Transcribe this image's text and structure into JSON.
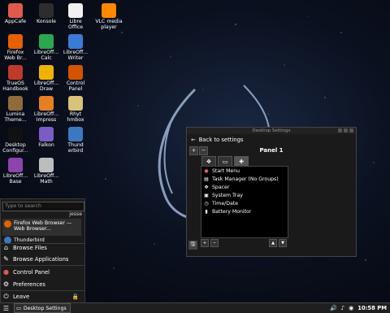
{
  "desktop": {
    "icons": [
      {
        "name": "appcafe",
        "label": "AppCafe",
        "icon": "appcafe-icon",
        "color": "#e05a4c"
      },
      {
        "name": "konsole",
        "label": "Konsole",
        "icon": "terminal-icon",
        "color": "#2d2d2d"
      },
      {
        "name": "libreoffice",
        "label": "Libre\nOffice",
        "icon": "document-icon",
        "color": "#f2f2f2"
      },
      {
        "name": "vlc",
        "label": "VLC media\nplayer",
        "icon": "vlc-cone-icon",
        "color": "#ff8800"
      },
      {
        "name": "firefox",
        "label": "Firefox\nWeb Br...",
        "icon": "firefox-icon",
        "color": "#e66000"
      },
      {
        "name": "calc",
        "label": "LibreOff...\nCalc",
        "icon": "spreadsheet-icon",
        "color": "#2aa74f"
      },
      {
        "name": "writer",
        "label": "LibreOff...\nWriter",
        "icon": "writer-icon",
        "color": "#3a7bd5"
      },
      {
        "name": "handbook",
        "label": "TrueOS\nHandbook",
        "icon": "handbook-icon",
        "color": "#c0392b"
      },
      {
        "name": "draw",
        "label": "LibreOff...\nDraw",
        "icon": "draw-icon",
        "color": "#f0b400"
      },
      {
        "name": "control-panel",
        "label": "Control\nPanel",
        "icon": "control-panel-icon",
        "color": "#d35400"
      },
      {
        "name": "lumina-theme",
        "label": "Lumina\nTheme...",
        "icon": "paint-palette-icon",
        "color": "#8e6c3a"
      },
      {
        "name": "impress",
        "label": "LibreOff...\nImpress",
        "icon": "impress-icon",
        "color": "#e67e22"
      },
      {
        "name": "rhythmbox",
        "label": "Rhyt\nhmbox",
        "icon": "rhythmbox-icon",
        "color": "#d9c27a"
      },
      {
        "name": "desktop-config",
        "label": "Desktop\nConfigur...",
        "icon": "monitor-icon",
        "color": "#111111"
      },
      {
        "name": "falkon",
        "label": "Falkon",
        "icon": "falkon-icon",
        "color": "#7b5cc4"
      },
      {
        "name": "thunderbird",
        "label": "Thund\nerbird",
        "icon": "thunderbird-icon",
        "color": "#3b78c2"
      },
      {
        "name": "base",
        "label": "LibreOff...\nBase",
        "icon": "base-icon",
        "color": "#8e44ad"
      },
      {
        "name": "math",
        "label": "LibreOff...\nMath",
        "icon": "math-icon",
        "color": "#bdbdbd"
      }
    ]
  },
  "start_menu": {
    "search_placeholder": "Type to search",
    "user": "jesse",
    "favorites": [
      {
        "label": "Firefox Web Browser — Web Browser...",
        "color": "#e66000"
      },
      {
        "label": "Thunderbird",
        "color": "#3b78c2"
      }
    ],
    "items": {
      "browse_files": "Browse Files",
      "browse_apps": "Browse Applications",
      "control_panel": "Control Panel",
      "preferences": "Preferences",
      "leave": "Leave"
    }
  },
  "window": {
    "title": "Desktop Settings",
    "back_label": "Back to settings",
    "panel_title": "Panel 1",
    "plugins": [
      {
        "label": "Start Menu",
        "icon": "start-menu-icon"
      },
      {
        "label": "Task Manager (No Groups)",
        "icon": "task-manager-icon"
      },
      {
        "label": "Spacer",
        "icon": "spacer-arrows-icon"
      },
      {
        "label": "System Tray",
        "icon": "system-tray-icon"
      },
      {
        "label": "Time/Date",
        "icon": "clock-icon"
      },
      {
        "label": "Battery Monitor",
        "icon": "battery-icon"
      }
    ]
  },
  "taskbar": {
    "task_label": "Desktop Settings",
    "clock": "10:58 PM"
  }
}
